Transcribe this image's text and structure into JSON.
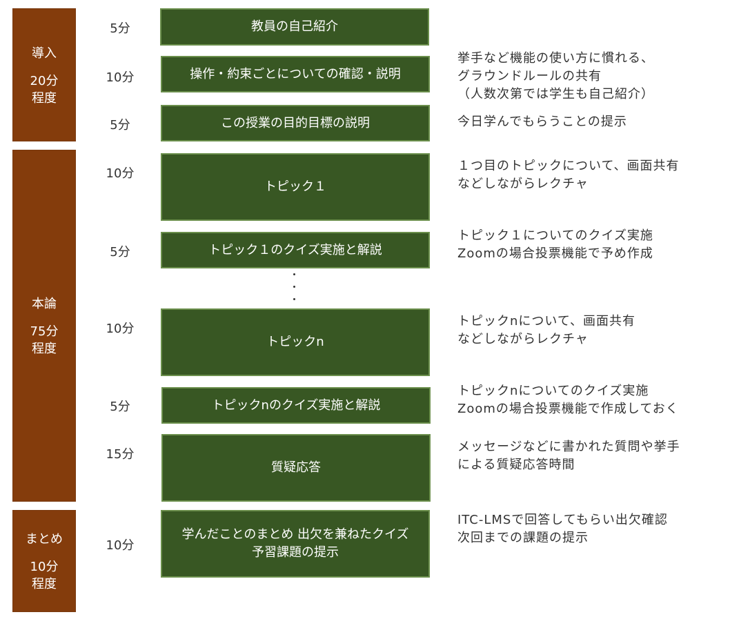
{
  "phases": [
    {
      "name": "導入",
      "duration_lines": [
        "20分",
        "程度"
      ]
    },
    {
      "name": "本論",
      "duration_lines": [
        "75分",
        "程度"
      ]
    },
    {
      "name": "まとめ",
      "duration_lines": [
        "10分",
        "程度"
      ]
    }
  ],
  "steps": [
    {
      "duration": "5分",
      "lines": [
        "教員の自己紹介"
      ],
      "notes": []
    },
    {
      "duration": "10分",
      "lines": [
        "操作・約束ごとについての確認・説明"
      ],
      "notes": [
        "挙手など機能の使い方に慣れる、",
        "グラウンドルールの共有",
        "（人数次第では学生も自己紹介）"
      ]
    },
    {
      "duration": "5分",
      "lines": [
        "この授業の目的目標の説明"
      ],
      "notes": [
        "今日学んでもらうことの提示"
      ]
    },
    {
      "duration": "10分",
      "lines": [
        "トピック１"
      ],
      "notes": [
        "１つ目のトピックについて、画面共有",
        "などしながらレクチャ"
      ]
    },
    {
      "duration": "5分",
      "lines": [
        "トピック１のクイズ実施と解説"
      ],
      "notes": [
        "トピック１についてのクイズ実施",
        "Zoomの場合投票機能で予め作成"
      ]
    },
    {
      "duration": "10分",
      "lines": [
        "トピックn"
      ],
      "notes": [
        "トピックnについて、画面共有",
        "などしながらレクチャ"
      ]
    },
    {
      "duration": "5分",
      "lines": [
        "トピックnのクイズ実施と解説"
      ],
      "notes": [
        "トピックnについてのクイズ実施",
        "Zoomの場合投票機能で作成しておく"
      ]
    },
    {
      "duration": "15分",
      "lines": [
        "質疑応答"
      ],
      "notes": [
        "メッセージなどに書かれた質問や挙手",
        "による質疑応答時間"
      ]
    },
    {
      "duration": "10分",
      "lines": [
        "学んだことのまとめ 出欠を兼ねたクイズ",
        "予習課題の提示"
      ],
      "notes": [
        "ITC-LMSで回答してもらい出欠確認",
        "次回までの課題の提示"
      ]
    }
  ],
  "colors": {
    "phase": "#843c0c",
    "step": "#385723",
    "step_border": "#6b8f4c"
  }
}
